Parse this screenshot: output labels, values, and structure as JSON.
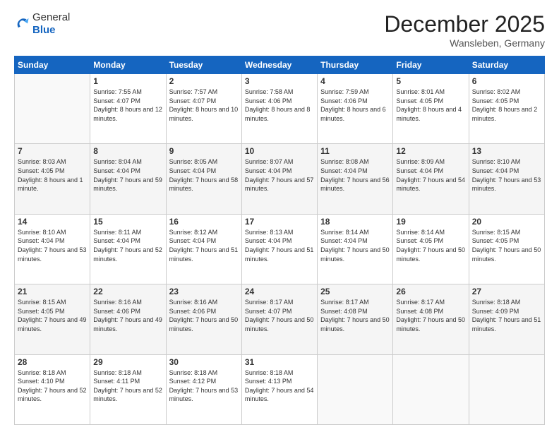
{
  "logo": {
    "general": "General",
    "blue": "Blue"
  },
  "title": "December 2025",
  "subtitle": "Wansleben, Germany",
  "days_of_week": [
    "Sunday",
    "Monday",
    "Tuesday",
    "Wednesday",
    "Thursday",
    "Friday",
    "Saturday"
  ],
  "weeks": [
    [
      {
        "day": "",
        "sunrise": "",
        "sunset": "",
        "daylight": "",
        "empty": true
      },
      {
        "day": "1",
        "sunrise": "Sunrise: 7:55 AM",
        "sunset": "Sunset: 4:07 PM",
        "daylight": "Daylight: 8 hours and 12 minutes."
      },
      {
        "day": "2",
        "sunrise": "Sunrise: 7:57 AM",
        "sunset": "Sunset: 4:07 PM",
        "daylight": "Daylight: 8 hours and 10 minutes."
      },
      {
        "day": "3",
        "sunrise": "Sunrise: 7:58 AM",
        "sunset": "Sunset: 4:06 PM",
        "daylight": "Daylight: 8 hours and 8 minutes."
      },
      {
        "day": "4",
        "sunrise": "Sunrise: 7:59 AM",
        "sunset": "Sunset: 4:06 PM",
        "daylight": "Daylight: 8 hours and 6 minutes."
      },
      {
        "day": "5",
        "sunrise": "Sunrise: 8:01 AM",
        "sunset": "Sunset: 4:05 PM",
        "daylight": "Daylight: 8 hours and 4 minutes."
      },
      {
        "day": "6",
        "sunrise": "Sunrise: 8:02 AM",
        "sunset": "Sunset: 4:05 PM",
        "daylight": "Daylight: 8 hours and 2 minutes."
      }
    ],
    [
      {
        "day": "7",
        "sunrise": "Sunrise: 8:03 AM",
        "sunset": "Sunset: 4:05 PM",
        "daylight": "Daylight: 8 hours and 1 minute."
      },
      {
        "day": "8",
        "sunrise": "Sunrise: 8:04 AM",
        "sunset": "Sunset: 4:04 PM",
        "daylight": "Daylight: 7 hours and 59 minutes."
      },
      {
        "day": "9",
        "sunrise": "Sunrise: 8:05 AM",
        "sunset": "Sunset: 4:04 PM",
        "daylight": "Daylight: 7 hours and 58 minutes."
      },
      {
        "day": "10",
        "sunrise": "Sunrise: 8:07 AM",
        "sunset": "Sunset: 4:04 PM",
        "daylight": "Daylight: 7 hours and 57 minutes."
      },
      {
        "day": "11",
        "sunrise": "Sunrise: 8:08 AM",
        "sunset": "Sunset: 4:04 PM",
        "daylight": "Daylight: 7 hours and 56 minutes."
      },
      {
        "day": "12",
        "sunrise": "Sunrise: 8:09 AM",
        "sunset": "Sunset: 4:04 PM",
        "daylight": "Daylight: 7 hours and 54 minutes."
      },
      {
        "day": "13",
        "sunrise": "Sunrise: 8:10 AM",
        "sunset": "Sunset: 4:04 PM",
        "daylight": "Daylight: 7 hours and 53 minutes."
      }
    ],
    [
      {
        "day": "14",
        "sunrise": "Sunrise: 8:10 AM",
        "sunset": "Sunset: 4:04 PM",
        "daylight": "Daylight: 7 hours and 53 minutes."
      },
      {
        "day": "15",
        "sunrise": "Sunrise: 8:11 AM",
        "sunset": "Sunset: 4:04 PM",
        "daylight": "Daylight: 7 hours and 52 minutes."
      },
      {
        "day": "16",
        "sunrise": "Sunrise: 8:12 AM",
        "sunset": "Sunset: 4:04 PM",
        "daylight": "Daylight: 7 hours and 51 minutes."
      },
      {
        "day": "17",
        "sunrise": "Sunrise: 8:13 AM",
        "sunset": "Sunset: 4:04 PM",
        "daylight": "Daylight: 7 hours and 51 minutes."
      },
      {
        "day": "18",
        "sunrise": "Sunrise: 8:14 AM",
        "sunset": "Sunset: 4:04 PM",
        "daylight": "Daylight: 7 hours and 50 minutes."
      },
      {
        "day": "19",
        "sunrise": "Sunrise: 8:14 AM",
        "sunset": "Sunset: 4:05 PM",
        "daylight": "Daylight: 7 hours and 50 minutes."
      },
      {
        "day": "20",
        "sunrise": "Sunrise: 8:15 AM",
        "sunset": "Sunset: 4:05 PM",
        "daylight": "Daylight: 7 hours and 50 minutes."
      }
    ],
    [
      {
        "day": "21",
        "sunrise": "Sunrise: 8:15 AM",
        "sunset": "Sunset: 4:05 PM",
        "daylight": "Daylight: 7 hours and 49 minutes."
      },
      {
        "day": "22",
        "sunrise": "Sunrise: 8:16 AM",
        "sunset": "Sunset: 4:06 PM",
        "daylight": "Daylight: 7 hours and 49 minutes."
      },
      {
        "day": "23",
        "sunrise": "Sunrise: 8:16 AM",
        "sunset": "Sunset: 4:06 PM",
        "daylight": "Daylight: 7 hours and 50 minutes."
      },
      {
        "day": "24",
        "sunrise": "Sunrise: 8:17 AM",
        "sunset": "Sunset: 4:07 PM",
        "daylight": "Daylight: 7 hours and 50 minutes."
      },
      {
        "day": "25",
        "sunrise": "Sunrise: 8:17 AM",
        "sunset": "Sunset: 4:08 PM",
        "daylight": "Daylight: 7 hours and 50 minutes."
      },
      {
        "day": "26",
        "sunrise": "Sunrise: 8:17 AM",
        "sunset": "Sunset: 4:08 PM",
        "daylight": "Daylight: 7 hours and 50 minutes."
      },
      {
        "day": "27",
        "sunrise": "Sunrise: 8:18 AM",
        "sunset": "Sunset: 4:09 PM",
        "daylight": "Daylight: 7 hours and 51 minutes."
      }
    ],
    [
      {
        "day": "28",
        "sunrise": "Sunrise: 8:18 AM",
        "sunset": "Sunset: 4:10 PM",
        "daylight": "Daylight: 7 hours and 52 minutes."
      },
      {
        "day": "29",
        "sunrise": "Sunrise: 8:18 AM",
        "sunset": "Sunset: 4:11 PM",
        "daylight": "Daylight: 7 hours and 52 minutes."
      },
      {
        "day": "30",
        "sunrise": "Sunrise: 8:18 AM",
        "sunset": "Sunset: 4:12 PM",
        "daylight": "Daylight: 7 hours and 53 minutes."
      },
      {
        "day": "31",
        "sunrise": "Sunrise: 8:18 AM",
        "sunset": "Sunset: 4:13 PM",
        "daylight": "Daylight: 7 hours and 54 minutes."
      },
      {
        "day": "",
        "sunrise": "",
        "sunset": "",
        "daylight": "",
        "empty": true
      },
      {
        "day": "",
        "sunrise": "",
        "sunset": "",
        "daylight": "",
        "empty": true
      },
      {
        "day": "",
        "sunrise": "",
        "sunset": "",
        "daylight": "",
        "empty": true
      }
    ]
  ]
}
